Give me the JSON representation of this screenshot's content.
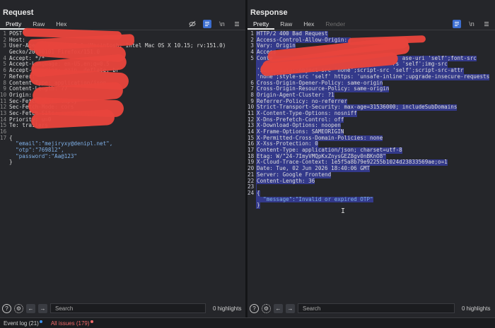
{
  "request": {
    "title": "Request",
    "tabs": [
      {
        "label": "Pretty",
        "active": true
      },
      {
        "label": "Raw",
        "active": false
      },
      {
        "label": "Hex",
        "active": false
      }
    ],
    "tool_newline": "\\n",
    "lines": [
      {
        "n": "1",
        "t": "POST"
      },
      {
        "n": "2",
        "t": "Host: "
      },
      {
        "n": "3",
        "t": "User-Agent: Mozilla/5.0 (Macintosh; Intel Mac OS X 10.15; rv:151.0)"
      },
      {
        "n": "",
        "t": "Gecko/20100101 Firefox/151.0"
      },
      {
        "n": "4",
        "t": "Accept: */*"
      },
      {
        "n": "5",
        "t": "Accept-Language: en-US,en;q=0.5"
      },
      {
        "n": "6",
        "t": "Accept-Encoding: gzip, deflate, br"
      },
      {
        "n": "7",
        "t": "Referer: "
      },
      {
        "n": "8",
        "t": "Content-Type: application/json"
      },
      {
        "n": "9",
        "t": "Content-Length: 77"
      },
      {
        "n": "10",
        "t": "Origin: "
      },
      {
        "n": "11",
        "t": "Sec-Fetch-Dest: empty"
      },
      {
        "n": "12",
        "t": "Sec-Fetch-Mode: cors"
      },
      {
        "n": "13",
        "t": "Sec-Fetch-Site: same-origin"
      },
      {
        "n": "14",
        "t": "Priority: u=0"
      },
      {
        "n": "15",
        "t": "Te: trailers"
      },
      {
        "n": "16",
        "t": ""
      },
      {
        "n": "17",
        "t": "{"
      },
      {
        "n": "",
        "t": "  \"email\":\"mejiryxy@denipl.net\","
      },
      {
        "n": "",
        "t": "  \"otp\":\"769812\","
      },
      {
        "n": "",
        "t": "  \"password\":\"Aa@123\""
      },
      {
        "n": "",
        "t": "}"
      }
    ],
    "search_placeholder": "Search",
    "highlights": "0 highlights"
  },
  "response": {
    "title": "Response",
    "tabs": [
      {
        "label": "Pretty",
        "active": true
      },
      {
        "label": "Raw",
        "active": false
      },
      {
        "label": "Hex",
        "active": false
      },
      {
        "label": "Render",
        "active": false
      }
    ],
    "tool_newline": "\\n",
    "lines": [
      {
        "n": "1",
        "t": "HTTP/2 400 Bad Request"
      },
      {
        "n": "2",
        "t": "Access-Control-Allow-Origin: "
      },
      {
        "n": "3",
        "t": "Vary: Origin"
      },
      {
        "n": "4",
        "t": "Access"
      },
      {
        "n": "5",
        "t": "Conte                                        ase-uri 'self';font-src"
      },
      {
        "n": "",
        "t": "                                          rs 'self';img-src"
      },
      {
        "n": "",
        "t": "'self' data:;object-src 'none';script-src 'self';script-src-attr"
      },
      {
        "n": "",
        "t": "'none';style-src 'self' https: 'unsafe-inline';upgrade-insecure-requests"
      },
      {
        "n": "6",
        "t": "Cross-Origin-Opener-Policy: same-origin"
      },
      {
        "n": "7",
        "t": "Cross-Origin-Resource-Policy: same-origin"
      },
      {
        "n": "8",
        "t": "Origin-Agent-Cluster: ?1"
      },
      {
        "n": "9",
        "t": "Referrer-Policy: no-referrer"
      },
      {
        "n": "10",
        "t": "Strict-Transport-Security: max-age=31536000; includeSubDomains"
      },
      {
        "n": "11",
        "t": "X-Content-Type-Options: nosniff"
      },
      {
        "n": "12",
        "t": "X-Dns-Prefetch-Control: off"
      },
      {
        "n": "13",
        "t": "X-Download-Options: noopen"
      },
      {
        "n": "14",
        "t": "X-Frame-Options: SAMEORIGIN"
      },
      {
        "n": "15",
        "t": "X-Permitted-Cross-Domain-Policies: none"
      },
      {
        "n": "16",
        "t": "X-Xss-Protection: 0"
      },
      {
        "n": "17",
        "t": "Content-Type: application/json; charset=utf-8"
      },
      {
        "n": "18",
        "t": "Etag: W/\"24-7ImyVMQpKxZnysGEZ8gv0nBKnO8\""
      },
      {
        "n": "19",
        "t": "X-Cloud-Trace-Context: 1e5f5a8b79e92255b1024d23833569ae;o=1"
      },
      {
        "n": "20",
        "t": "Date: Tue, 02 Jun 2026 18:40:06 GMT"
      },
      {
        "n": "21",
        "t": "Server: Google Frontend"
      },
      {
        "n": "22",
        "t": "Content-Length: 36"
      },
      {
        "n": "23",
        "t": ""
      },
      {
        "n": "24",
        "t": "{"
      },
      {
        "n": "",
        "t": "  \"message\":\"Invalid or expired OTP\""
      },
      {
        "n": "",
        "t": "}"
      }
    ],
    "search_placeholder": "Search",
    "highlights": "0 highlights"
  },
  "statusbar": {
    "event_log": "Event log (21)",
    "all_issues": "All issues (179)"
  },
  "colors": {
    "selection": "#33398a",
    "accent": "#3c6ed1",
    "redaction": "#e8453c",
    "issues": "#f06a6a"
  },
  "icons": [
    "eye-off-icon",
    "wrap-icon",
    "newline-icon",
    "menu-icon",
    "help-icon",
    "gear-icon",
    "arrow-left-icon",
    "arrow-right-icon",
    "layout-split-icon"
  ]
}
